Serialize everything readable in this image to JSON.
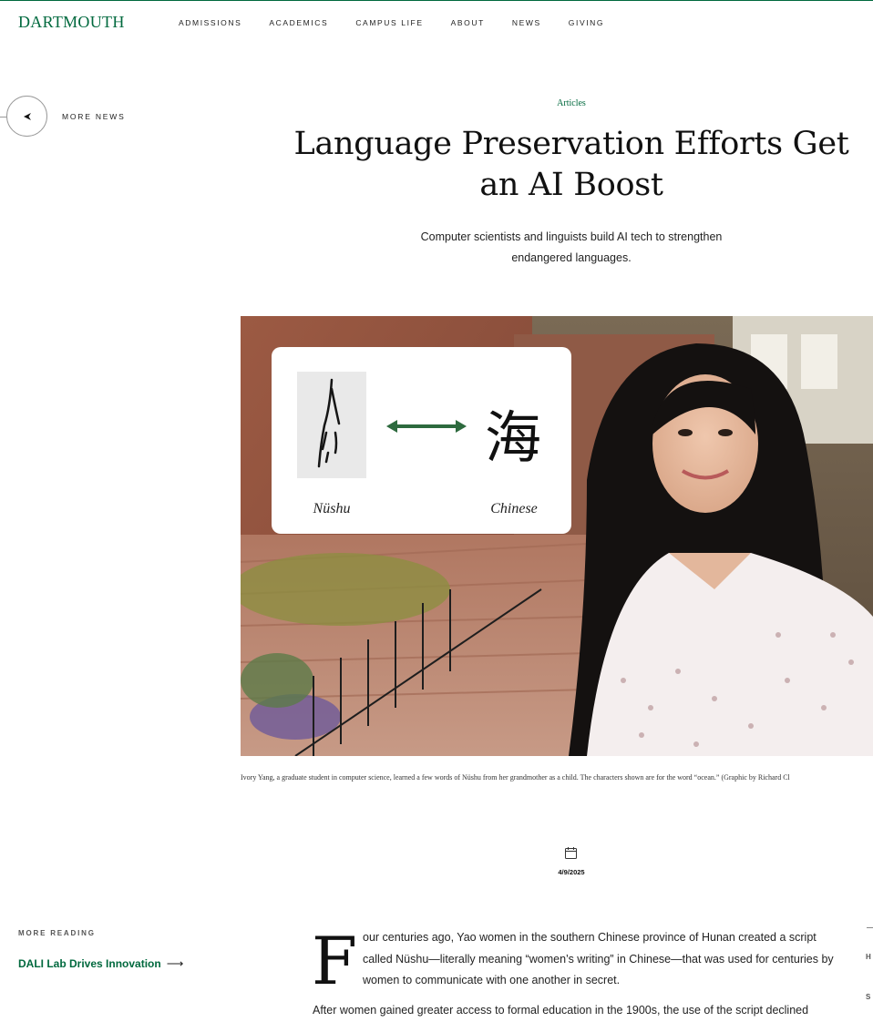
{
  "header": {
    "logo": "DARTMOUTH",
    "nav": [
      "ADMISSIONS",
      "ACADEMICS",
      "CAMPUS LIFE",
      "ABOUT",
      "NEWS",
      "GIVING"
    ]
  },
  "back": {
    "label": "MORE NEWS",
    "icon": "chevron-left-icon"
  },
  "article": {
    "category": "Articles",
    "title": "Language Preservation Efforts Get an AI Boost",
    "dek": "Computer scientists and linguists build AI tech to strengthen endangered languages.",
    "graphic": {
      "left_label": "Nüshu",
      "right_label": "Chinese",
      "chinese_character": "海"
    },
    "caption": "Ivory Yang, a graduate student in computer science, learned a few words of Nüshu from her grandmother as a child. The characters shown are for the word “ocean.” (Graphic by Richard Cl",
    "date": "4/9/2025",
    "dropcap": "F",
    "paragraph1_rest": "our centuries ago, Yao women in the southern Chinese province of Hunan created a script called Nüshu—literally meaning “women’s writing” in Chinese—that was used for centuries by women to communicate with one another in secret.",
    "paragraph2": "After women gained greater access to formal education in the 1900s, the use of the script declined"
  },
  "more_reading": {
    "heading": "MORE READING",
    "link": "DALI Lab Drives Innovation",
    "arrow": "⟶"
  },
  "right_rail": {
    "h": "H",
    "s": "S"
  },
  "colors": {
    "brand_green": "#00693e"
  }
}
